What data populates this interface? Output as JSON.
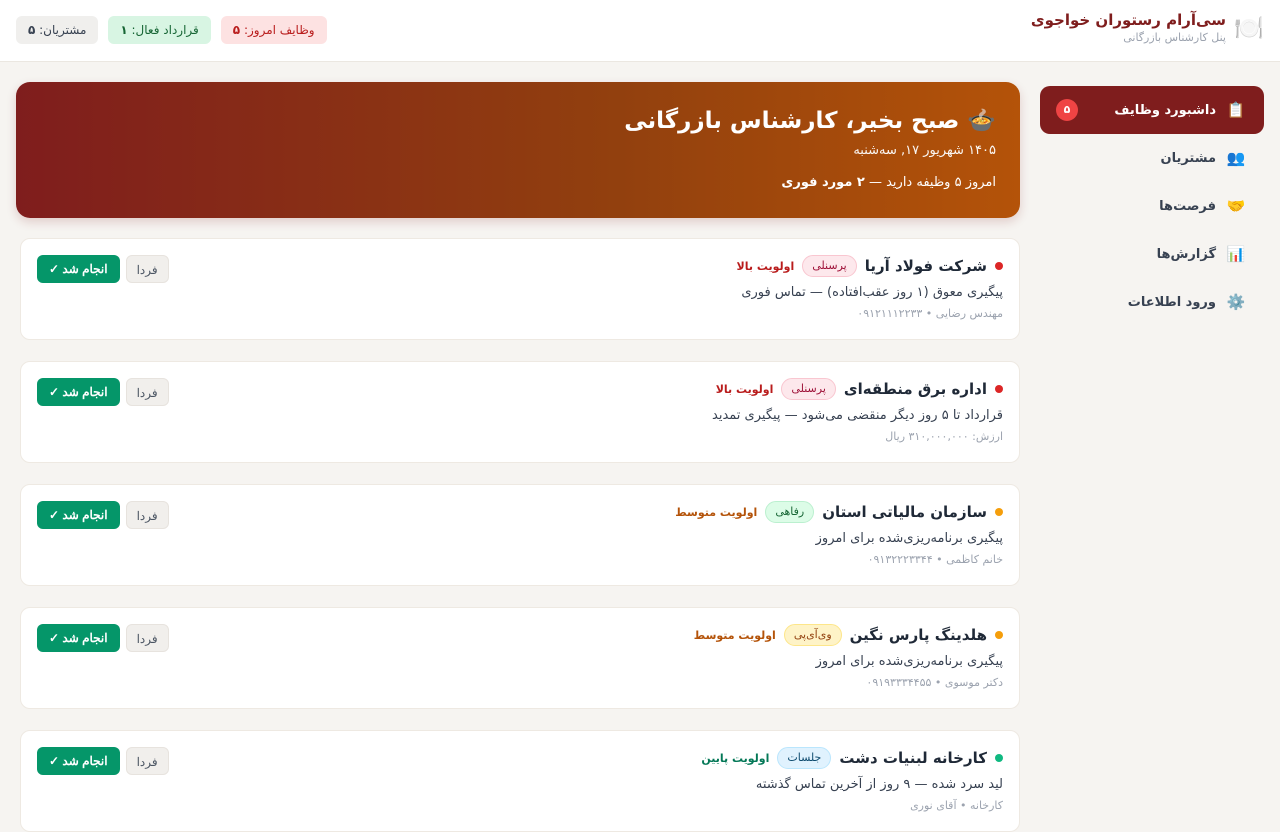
{
  "header": {
    "title": "سی‌آرام رستوران خواجوی",
    "subtitle": "پنل کارشناس بازرگانی",
    "logo_icon": "plate-icon",
    "stats": [
      {
        "label": "مشتریان: ",
        "value": "۵",
        "tone": "gray"
      },
      {
        "label": "قرارداد فعال: ",
        "value": "۱",
        "tone": "green"
      },
      {
        "label": "وظایف امروز: ",
        "value": "۵",
        "tone": "red"
      }
    ]
  },
  "sidebar": {
    "items": [
      {
        "label": "داشبورد وظایف",
        "icon": "📋",
        "icon_name": "clipboard-icon",
        "badge": "۵",
        "active": true
      },
      {
        "label": "مشتریان",
        "icon": "👥",
        "icon_name": "users-icon",
        "badge": "",
        "active": false
      },
      {
        "label": "فرصت‌ها",
        "icon": "🤝",
        "icon_name": "handshake-icon",
        "badge": "",
        "active": false
      },
      {
        "label": "گزارش‌ها",
        "icon": "📊",
        "icon_name": "chart-icon",
        "badge": "",
        "active": false
      },
      {
        "label": "ورود اطلاعات",
        "icon": "⚙️",
        "icon_name": "gear-icon",
        "badge": "",
        "active": false
      }
    ]
  },
  "hero": {
    "emoji": "🍲",
    "greeting": "صبح بخیر، کارشناس بازرگانی",
    "date": "۱۴۰۵ شهریور ۱۷, سه‌شنبه",
    "summary_prefix": "امروز ۵ وظیفه دارید — ",
    "summary_urgent": "۲ مورد فوری"
  },
  "task_actions": {
    "done_label": "انجام شد ✓",
    "later_label": "فردا"
  },
  "tasks": [
    {
      "name": "شرکت فولاد آریا",
      "tag": "پرسنلی",
      "tag_tone": "pink",
      "priority": "اولویت بالا",
      "priority_color": "#b91c1c",
      "dot_color": "#dc2626",
      "desc": "پیگیری معوق (۱ روز عقب‌افتاده) — تماس فوری",
      "meta": "مهندس رضایی • ۰۹۱۲۱۱۱۲۲۳۳"
    },
    {
      "name": "اداره برق منطقه‌ای",
      "tag": "پرسنلی",
      "tag_tone": "pink",
      "priority": "اولویت بالا",
      "priority_color": "#b91c1c",
      "dot_color": "#dc2626",
      "desc": "قرارداد تا ۵ روز دیگر منقضی می‌شود — پیگیری تمدید",
      "meta": "ارزش: ۳۱۰,۰۰۰,۰۰۰ ریال"
    },
    {
      "name": "سازمان مالیاتی استان",
      "tag": "رفاهی",
      "tag_tone": "green",
      "priority": "اولویت متوسط",
      "priority_color": "#b45309",
      "dot_color": "#f59e0b",
      "desc": "پیگیری برنامه‌ریزی‌شده برای امروز",
      "meta": "خانم کاظمی • ۰۹۱۳۲۲۲۳۳۴۴"
    },
    {
      "name": "هلدینگ پارس نگین",
      "tag": "وی‌آی‌پی",
      "tag_tone": "yellow",
      "priority": "اولویت متوسط",
      "priority_color": "#b45309",
      "dot_color": "#f59e0b",
      "desc": "پیگیری برنامه‌ریزی‌شده برای امروز",
      "meta": "دکتر موسوی • ۰۹۱۹۳۳۳۴۴۵۵"
    },
    {
      "name": "کارخانه لبنیات دشت",
      "tag": "جلسات",
      "tag_tone": "blue",
      "priority": "اولویت پایین",
      "priority_color": "#047857",
      "dot_color": "#10b981",
      "desc": "لید سرد شده — ۹ روز از آخرین تماس گذشته",
      "meta": "کارخانه • آقای نوری"
    }
  ]
}
